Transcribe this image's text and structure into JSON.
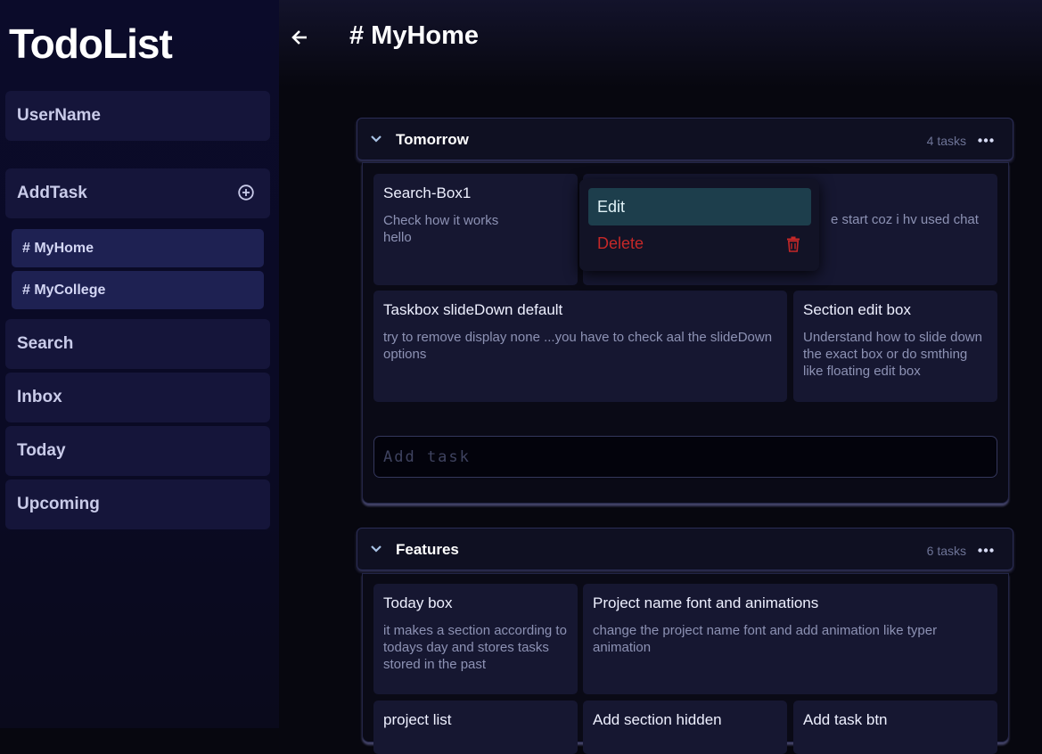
{
  "app": {
    "logo": "TodoList"
  },
  "sidebar": {
    "user": "UserName",
    "add_task": "AddTask",
    "projects": [
      {
        "label": "# MyHome"
      },
      {
        "label": "# MyCollege"
      }
    ],
    "nav": [
      {
        "label": "Search"
      },
      {
        "label": "Inbox"
      },
      {
        "label": "Today"
      },
      {
        "label": "Upcoming"
      }
    ]
  },
  "main": {
    "title": "# MyHome",
    "sections": [
      {
        "title": "Tomorrow",
        "count": "4 tasks",
        "tasks": [
          {
            "title": "Search-Box1",
            "desc": "Check how it works\nhello"
          },
          {
            "title": "",
            "desc": "e start coz i hv used chat"
          },
          {
            "title": "Taskbox slideDown default",
            "desc": "try to remove display none ...you have to check aal the slideDown options"
          },
          {
            "title": "Section edit box",
            "desc": "Understand how to slide down the exact box or do smthing like floating edit box"
          }
        ],
        "add_placeholder": "Add task"
      },
      {
        "title": "Features",
        "count": "6 tasks",
        "tasks": [
          {
            "title": "Today box",
            "desc": "it makes a section according to todays day and stores tasks stored in the past"
          },
          {
            "title": "Project name font and animations",
            "desc": "change the project name font and add animation like typer animation"
          },
          {
            "title": "project list",
            "desc": ""
          },
          {
            "title": "Add section hidden",
            "desc": ""
          },
          {
            "title": "Add task btn",
            "desc": ""
          }
        ]
      }
    ]
  },
  "context_menu": {
    "edit": "Edit",
    "delete": "Delete"
  }
}
